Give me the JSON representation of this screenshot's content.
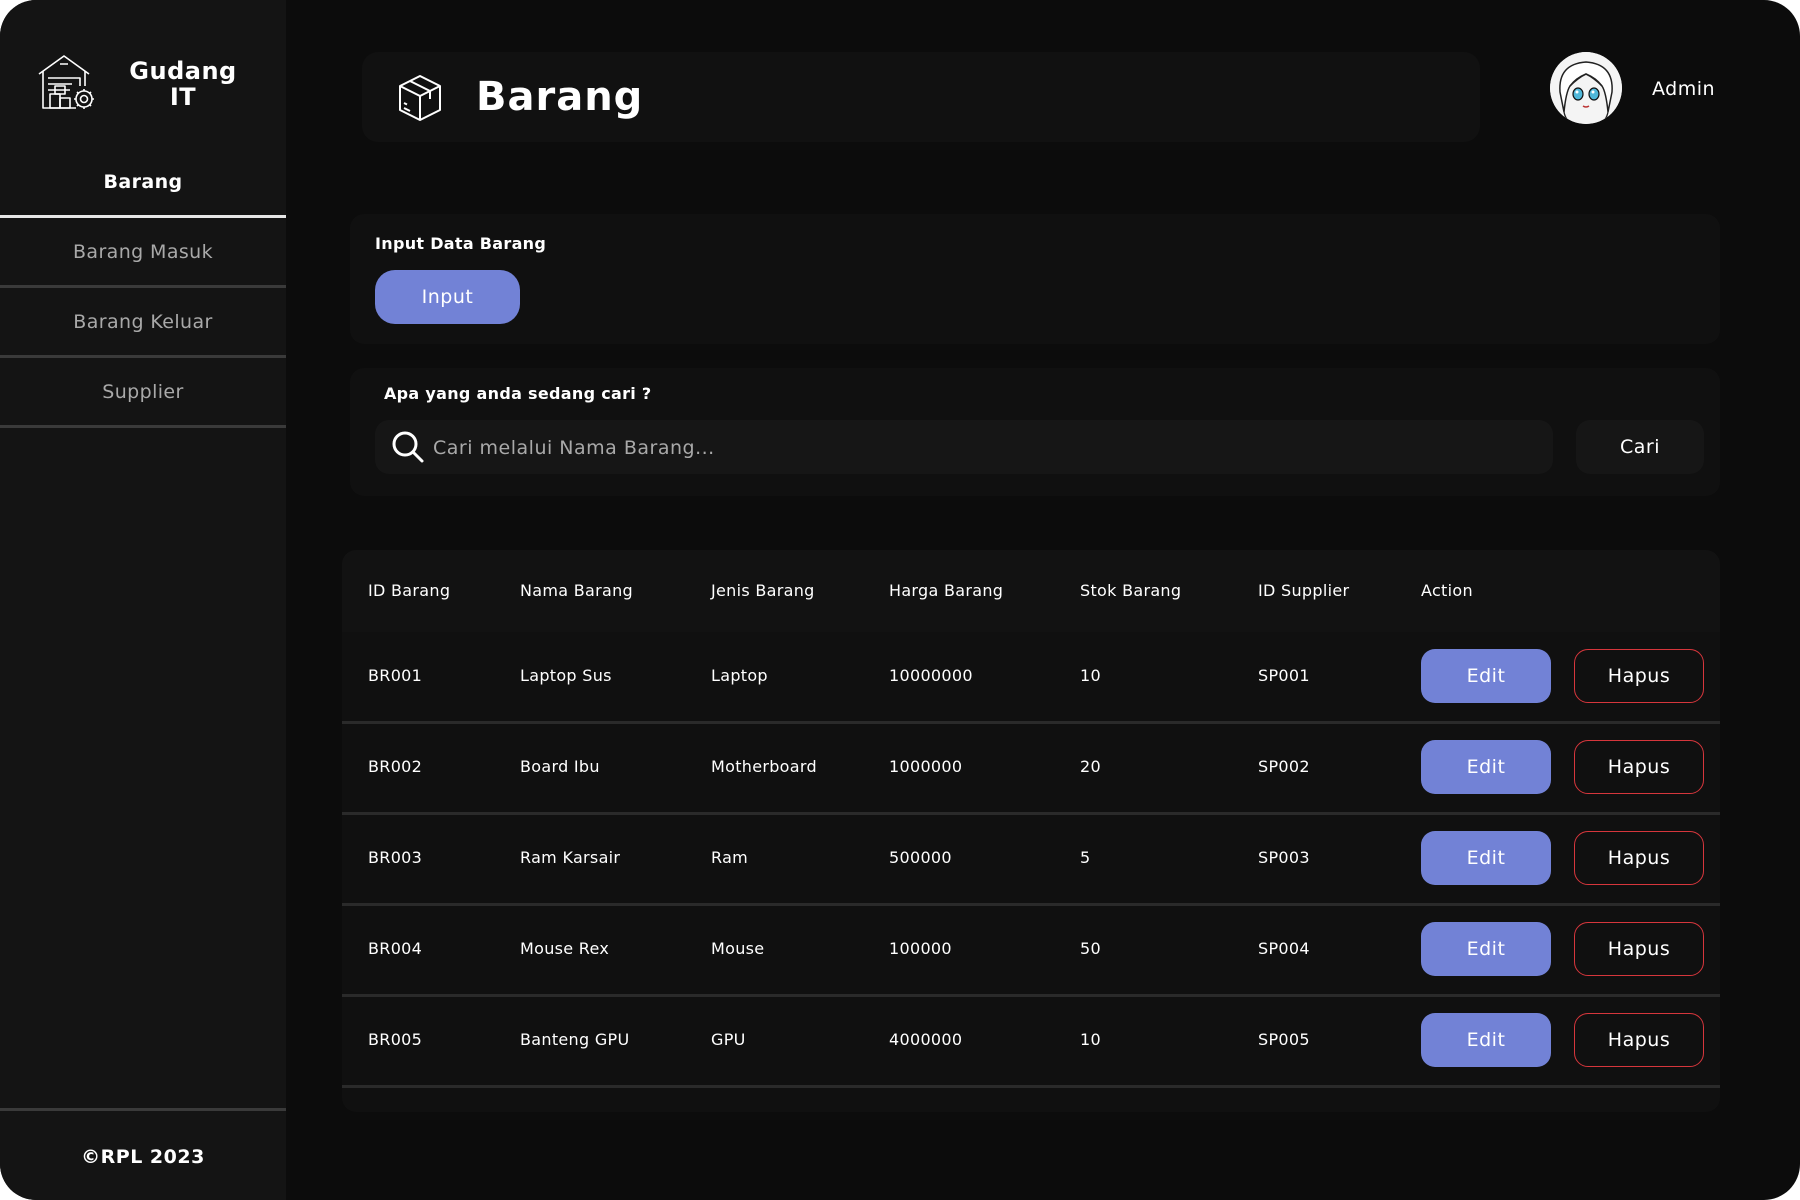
{
  "brand": {
    "name_line1": "Gudang",
    "name_line2": "IT"
  },
  "sidebar": {
    "items": [
      {
        "label": "Barang",
        "active": true
      },
      {
        "label": "Barang Masuk"
      },
      {
        "label": "Barang Keluar"
      },
      {
        "label": "Supplier"
      }
    ],
    "footer": "©RPL 2023"
  },
  "header": {
    "title": "Barang",
    "user": "Admin"
  },
  "input_section": {
    "label": "Input Data Barang",
    "button": "Input"
  },
  "search": {
    "label": "Apa yang anda sedang cari ?",
    "placeholder": "Cari melalui Nama Barang...",
    "button": "Cari"
  },
  "table": {
    "headers": [
      "ID Barang",
      "Nama Barang",
      "Jenis Barang",
      "Harga Barang",
      "Stok Barang",
      "ID Supplier",
      "Action"
    ],
    "rows": [
      [
        "BR001",
        "Laptop Sus",
        "Laptop",
        "10000000",
        "10",
        "SP001"
      ],
      [
        "BR002",
        "Board Ibu",
        "Motherboard",
        "1000000",
        "20",
        "SP002"
      ],
      [
        "BR003",
        "Ram Karsair",
        "Ram",
        "500000",
        "5",
        "SP003"
      ],
      [
        "BR004",
        "Mouse Rex",
        "Mouse",
        "100000",
        "50",
        "SP004"
      ],
      [
        "BR005",
        "Banteng GPU",
        "GPU",
        "4000000",
        "10",
        "SP005"
      ]
    ],
    "edit_label": "Edit",
    "delete_label": "Hapus"
  },
  "colors": {
    "accent": "#7282d6",
    "danger": "#d6363c",
    "background": "#0c0c0c",
    "sidebar": "#141414"
  },
  "icons": {
    "brand": "warehouse-icon",
    "header": "box-icon",
    "search": "search-icon"
  }
}
